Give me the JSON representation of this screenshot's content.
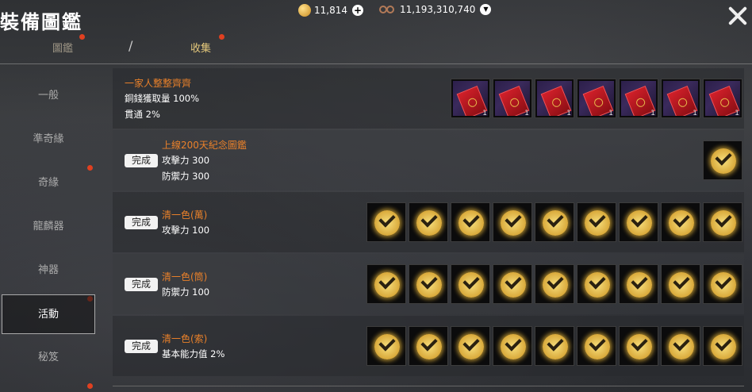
{
  "window": {
    "title": "裝備圖鑑"
  },
  "tabs": [
    {
      "label": "圖鑑"
    },
    {
      "label": "收集"
    }
  ],
  "tab_separator": "/",
  "currency": {
    "coins": "11,814",
    "gems": "11,193,310,740"
  },
  "sidebar": {
    "items": [
      {
        "label": "一般"
      },
      {
        "label": "準奇緣"
      },
      {
        "label": "奇緣"
      },
      {
        "label": "龍麟器"
      },
      {
        "label": "神器"
      },
      {
        "label": "活動"
      },
      {
        "label": "秘笈"
      }
    ],
    "active": "活動"
  },
  "rows": [
    {
      "name": "一家人整整齊齊",
      "stats": [
        "銅錢獲取量 100%",
        "貫通 2%"
      ],
      "button": "",
      "slot_type": "item",
      "slot_count": 7,
      "item_qty": "1"
    },
    {
      "name": "上線200天紀念圖鑑",
      "stats": [
        "攻擊力 300",
        "防禦力 300"
      ],
      "button": "完成",
      "slot_type": "check",
      "slot_count": 1
    },
    {
      "name": "清一色(萬)",
      "stats": [
        "攻擊力 100"
      ],
      "button": "完成",
      "slot_type": "check",
      "slot_count": 9
    },
    {
      "name": "清一色(筒)",
      "stats": [
        "防禦力 100"
      ],
      "button": "完成",
      "slot_type": "check",
      "slot_count": 9
    },
    {
      "name": "清一色(索)",
      "stats": [
        "基本能力值 2%"
      ],
      "button": "完成",
      "slot_type": "check",
      "slot_count": 9
    }
  ],
  "colors": {
    "row_name": "#e8802a",
    "accent_gold": "#e3c77b",
    "notify_dot": "#e04020"
  },
  "icons": {
    "close": "close-icon",
    "check": "check-circle-icon",
    "coin": "coin-icon",
    "gem": "prayer-beads-icon",
    "add": "plus-icon",
    "dropdown": "chevron-down-icon",
    "item": "red-envelope-icon"
  }
}
